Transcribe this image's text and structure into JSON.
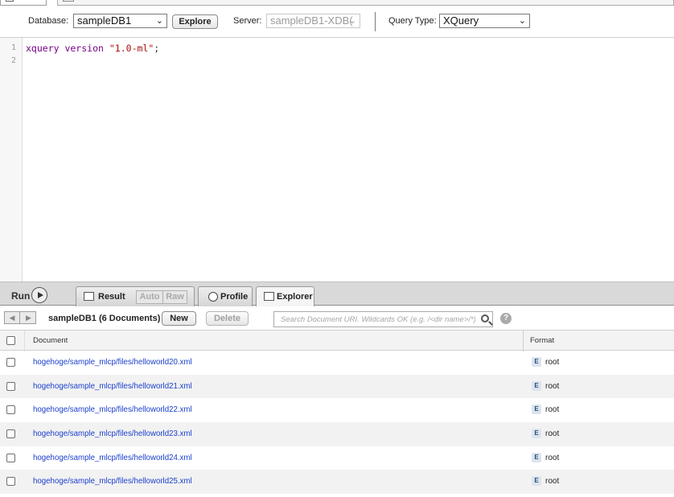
{
  "toolbar": {
    "database_label": "Database:",
    "database_value": "sampleDB1",
    "explore_button": "Explore",
    "server_label": "Server:",
    "server_value": "sampleDB1-XDB(",
    "query_type_label": "Query Type:",
    "query_type_value": "XQuery"
  },
  "editor": {
    "line_numbers": [
      "1",
      "2"
    ],
    "line1": {
      "keyword": "xquery version",
      "string": "\"1.0-ml\"",
      "terminator": ";"
    }
  },
  "panel": {
    "run_label": "Run",
    "tabs": {
      "result": "Result",
      "auto": "Auto",
      "raw": "Raw",
      "profile": "Profile",
      "explorer": "Explorer"
    }
  },
  "explorer": {
    "db_title": "sampleDB1 (6 Documents)",
    "new_button": "New",
    "delete_button": "Delete",
    "search_placeholder": "Search Document URI. Wildcards OK (e.g. /<dir name>/*)",
    "help": "?",
    "columns": {
      "document": "Document",
      "format": "Format"
    },
    "rows": [
      {
        "uri": "hogehoge/sample_mlcp/files/helloworld20.xml",
        "badge": "E",
        "format": "root"
      },
      {
        "uri": "hogehoge/sample_mlcp/files/helloworld21.xml",
        "badge": "E",
        "format": "root"
      },
      {
        "uri": "hogehoge/sample_mlcp/files/helloworld22.xml",
        "badge": "E",
        "format": "root"
      },
      {
        "uri": "hogehoge/sample_mlcp/files/helloworld23.xml",
        "badge": "E",
        "format": "root"
      },
      {
        "uri": "hogehoge/sample_mlcp/files/helloworld24.xml",
        "badge": "E",
        "format": "root"
      },
      {
        "uri": "hogehoge/sample_mlcp/files/helloworld25.xml",
        "badge": "E",
        "format": "root"
      }
    ]
  },
  "colors": {
    "link": "#1a3fcc",
    "keyword": "#770088",
    "string": "#aa1111",
    "panel_bg": "#d9d9d9",
    "row_alt": "#f2f2f2"
  }
}
